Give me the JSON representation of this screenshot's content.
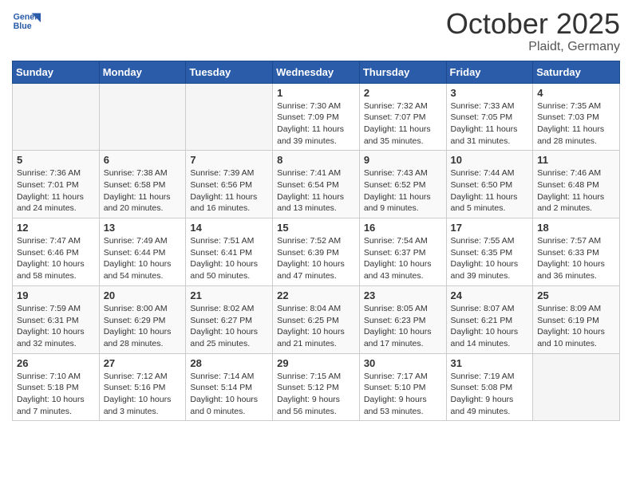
{
  "header": {
    "logo_general": "General",
    "logo_blue": "Blue",
    "month": "October 2025",
    "location": "Plaidt, Germany"
  },
  "days_of_week": [
    "Sunday",
    "Monday",
    "Tuesday",
    "Wednesday",
    "Thursday",
    "Friday",
    "Saturday"
  ],
  "weeks": [
    [
      {
        "day": "",
        "info": ""
      },
      {
        "day": "",
        "info": ""
      },
      {
        "day": "",
        "info": ""
      },
      {
        "day": "1",
        "info": "Sunrise: 7:30 AM\nSunset: 7:09 PM\nDaylight: 11 hours\nand 39 minutes."
      },
      {
        "day": "2",
        "info": "Sunrise: 7:32 AM\nSunset: 7:07 PM\nDaylight: 11 hours\nand 35 minutes."
      },
      {
        "day": "3",
        "info": "Sunrise: 7:33 AM\nSunset: 7:05 PM\nDaylight: 11 hours\nand 31 minutes."
      },
      {
        "day": "4",
        "info": "Sunrise: 7:35 AM\nSunset: 7:03 PM\nDaylight: 11 hours\nand 28 minutes."
      }
    ],
    [
      {
        "day": "5",
        "info": "Sunrise: 7:36 AM\nSunset: 7:01 PM\nDaylight: 11 hours\nand 24 minutes."
      },
      {
        "day": "6",
        "info": "Sunrise: 7:38 AM\nSunset: 6:58 PM\nDaylight: 11 hours\nand 20 minutes."
      },
      {
        "day": "7",
        "info": "Sunrise: 7:39 AM\nSunset: 6:56 PM\nDaylight: 11 hours\nand 16 minutes."
      },
      {
        "day": "8",
        "info": "Sunrise: 7:41 AM\nSunset: 6:54 PM\nDaylight: 11 hours\nand 13 minutes."
      },
      {
        "day": "9",
        "info": "Sunrise: 7:43 AM\nSunset: 6:52 PM\nDaylight: 11 hours\nand 9 minutes."
      },
      {
        "day": "10",
        "info": "Sunrise: 7:44 AM\nSunset: 6:50 PM\nDaylight: 11 hours\nand 5 minutes."
      },
      {
        "day": "11",
        "info": "Sunrise: 7:46 AM\nSunset: 6:48 PM\nDaylight: 11 hours\nand 2 minutes."
      }
    ],
    [
      {
        "day": "12",
        "info": "Sunrise: 7:47 AM\nSunset: 6:46 PM\nDaylight: 10 hours\nand 58 minutes."
      },
      {
        "day": "13",
        "info": "Sunrise: 7:49 AM\nSunset: 6:44 PM\nDaylight: 10 hours\nand 54 minutes."
      },
      {
        "day": "14",
        "info": "Sunrise: 7:51 AM\nSunset: 6:41 PM\nDaylight: 10 hours\nand 50 minutes."
      },
      {
        "day": "15",
        "info": "Sunrise: 7:52 AM\nSunset: 6:39 PM\nDaylight: 10 hours\nand 47 minutes."
      },
      {
        "day": "16",
        "info": "Sunrise: 7:54 AM\nSunset: 6:37 PM\nDaylight: 10 hours\nand 43 minutes."
      },
      {
        "day": "17",
        "info": "Sunrise: 7:55 AM\nSunset: 6:35 PM\nDaylight: 10 hours\nand 39 minutes."
      },
      {
        "day": "18",
        "info": "Sunrise: 7:57 AM\nSunset: 6:33 PM\nDaylight: 10 hours\nand 36 minutes."
      }
    ],
    [
      {
        "day": "19",
        "info": "Sunrise: 7:59 AM\nSunset: 6:31 PM\nDaylight: 10 hours\nand 32 minutes."
      },
      {
        "day": "20",
        "info": "Sunrise: 8:00 AM\nSunset: 6:29 PM\nDaylight: 10 hours\nand 28 minutes."
      },
      {
        "day": "21",
        "info": "Sunrise: 8:02 AM\nSunset: 6:27 PM\nDaylight: 10 hours\nand 25 minutes."
      },
      {
        "day": "22",
        "info": "Sunrise: 8:04 AM\nSunset: 6:25 PM\nDaylight: 10 hours\nand 21 minutes."
      },
      {
        "day": "23",
        "info": "Sunrise: 8:05 AM\nSunset: 6:23 PM\nDaylight: 10 hours\nand 17 minutes."
      },
      {
        "day": "24",
        "info": "Sunrise: 8:07 AM\nSunset: 6:21 PM\nDaylight: 10 hours\nand 14 minutes."
      },
      {
        "day": "25",
        "info": "Sunrise: 8:09 AM\nSunset: 6:19 PM\nDaylight: 10 hours\nand 10 minutes."
      }
    ],
    [
      {
        "day": "26",
        "info": "Sunrise: 7:10 AM\nSunset: 5:18 PM\nDaylight: 10 hours\nand 7 minutes."
      },
      {
        "day": "27",
        "info": "Sunrise: 7:12 AM\nSunset: 5:16 PM\nDaylight: 10 hours\nand 3 minutes."
      },
      {
        "day": "28",
        "info": "Sunrise: 7:14 AM\nSunset: 5:14 PM\nDaylight: 10 hours\nand 0 minutes."
      },
      {
        "day": "29",
        "info": "Sunrise: 7:15 AM\nSunset: 5:12 PM\nDaylight: 9 hours\nand 56 minutes."
      },
      {
        "day": "30",
        "info": "Sunrise: 7:17 AM\nSunset: 5:10 PM\nDaylight: 9 hours\nand 53 minutes."
      },
      {
        "day": "31",
        "info": "Sunrise: 7:19 AM\nSunset: 5:08 PM\nDaylight: 9 hours\nand 49 minutes."
      },
      {
        "day": "",
        "info": ""
      }
    ]
  ]
}
